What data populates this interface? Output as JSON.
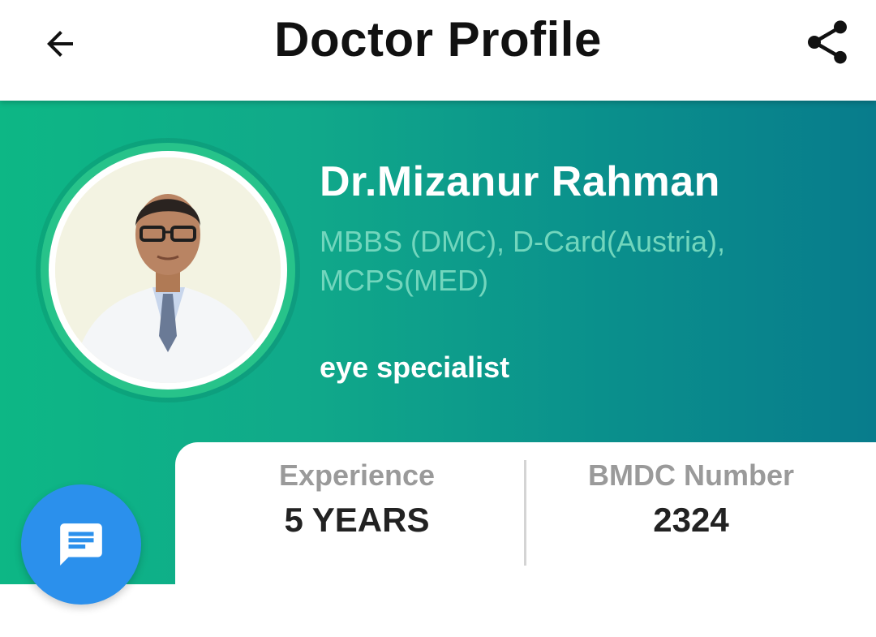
{
  "header": {
    "title": "Doctor Profile",
    "back_icon": "arrow-left-icon",
    "share_icon": "share-icon"
  },
  "doctor": {
    "name": "Dr.Mizanur Rahman",
    "degrees": "MBBS (DMC), D-Card(Austria), MCPS(MED)",
    "specialty": "eye specialist"
  },
  "stats": {
    "experience_label": "Experience",
    "experience_value": "5 YEARS",
    "bmdc_label": "BMDC Number",
    "bmdc_value": "2324"
  },
  "fab": {
    "icon": "chat-message-icon"
  },
  "colors": {
    "gradient_start": "#0db785",
    "gradient_end": "#087c8c",
    "fab": "#2b90ec",
    "degree_text": "#72d6bd"
  }
}
